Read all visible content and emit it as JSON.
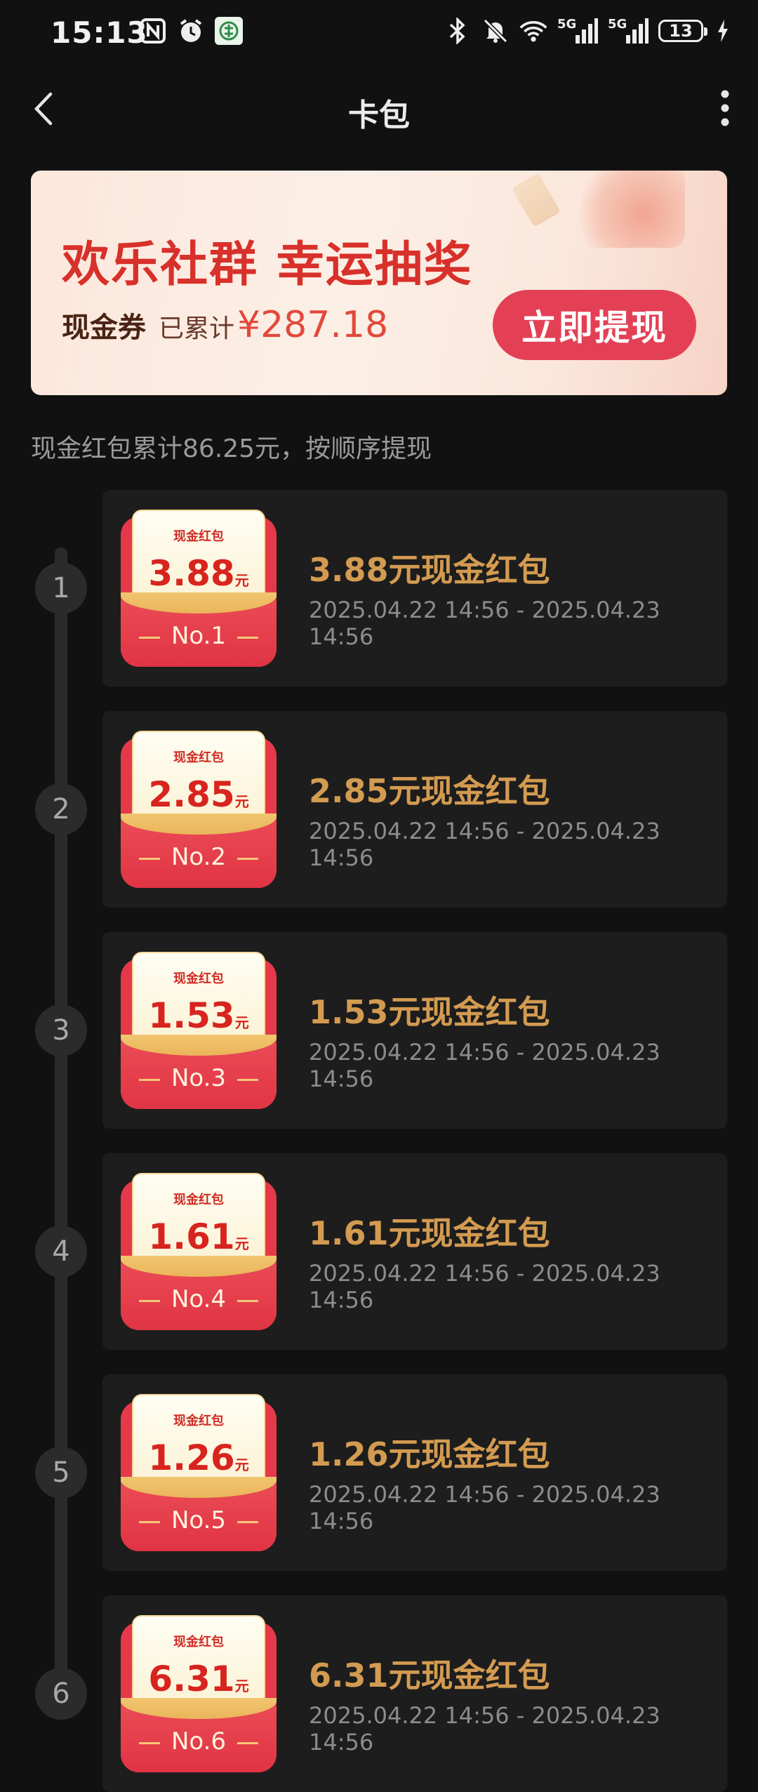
{
  "status_bar": {
    "time": "15:13",
    "battery": "13"
  },
  "header": {
    "title": "卡包"
  },
  "banner": {
    "title": "欢乐社群 幸运抽奖",
    "cash_label": "现金券",
    "accum_label": "已累计",
    "accum_value": "¥287.18",
    "button": "立即提现"
  },
  "summary": "现金红包累计86.25元，按顺序提现",
  "colors": {
    "accent": "#e34055",
    "gold": "#d39b51",
    "background": "#111111",
    "card": "#1d1d1d"
  },
  "items": [
    {
      "index": "1",
      "label": "现金红包",
      "amount": "3.88",
      "unit": "元",
      "no": "No.1",
      "title": "3.88元现金红包",
      "date": "2025.04.22 14:56 - 2025.04.23 14:56"
    },
    {
      "index": "2",
      "label": "现金红包",
      "amount": "2.85",
      "unit": "元",
      "no": "No.2",
      "title": "2.85元现金红包",
      "date": "2025.04.22 14:56 - 2025.04.23 14:56"
    },
    {
      "index": "3",
      "label": "现金红包",
      "amount": "1.53",
      "unit": "元",
      "no": "No.3",
      "title": "1.53元现金红包",
      "date": "2025.04.22 14:56 - 2025.04.23 14:56"
    },
    {
      "index": "4",
      "label": "现金红包",
      "amount": "1.61",
      "unit": "元",
      "no": "No.4",
      "title": "1.61元现金红包",
      "date": "2025.04.22 14:56 - 2025.04.23 14:56"
    },
    {
      "index": "5",
      "label": "现金红包",
      "amount": "1.26",
      "unit": "元",
      "no": "No.5",
      "title": "1.26元现金红包",
      "date": "2025.04.22 14:56 - 2025.04.23 14:56"
    },
    {
      "index": "6",
      "label": "现金红包",
      "amount": "6.31",
      "unit": "元",
      "no": "No.6",
      "title": "6.31元现金红包",
      "date": "2025.04.22 14:56 - 2025.04.23 14:56"
    }
  ]
}
